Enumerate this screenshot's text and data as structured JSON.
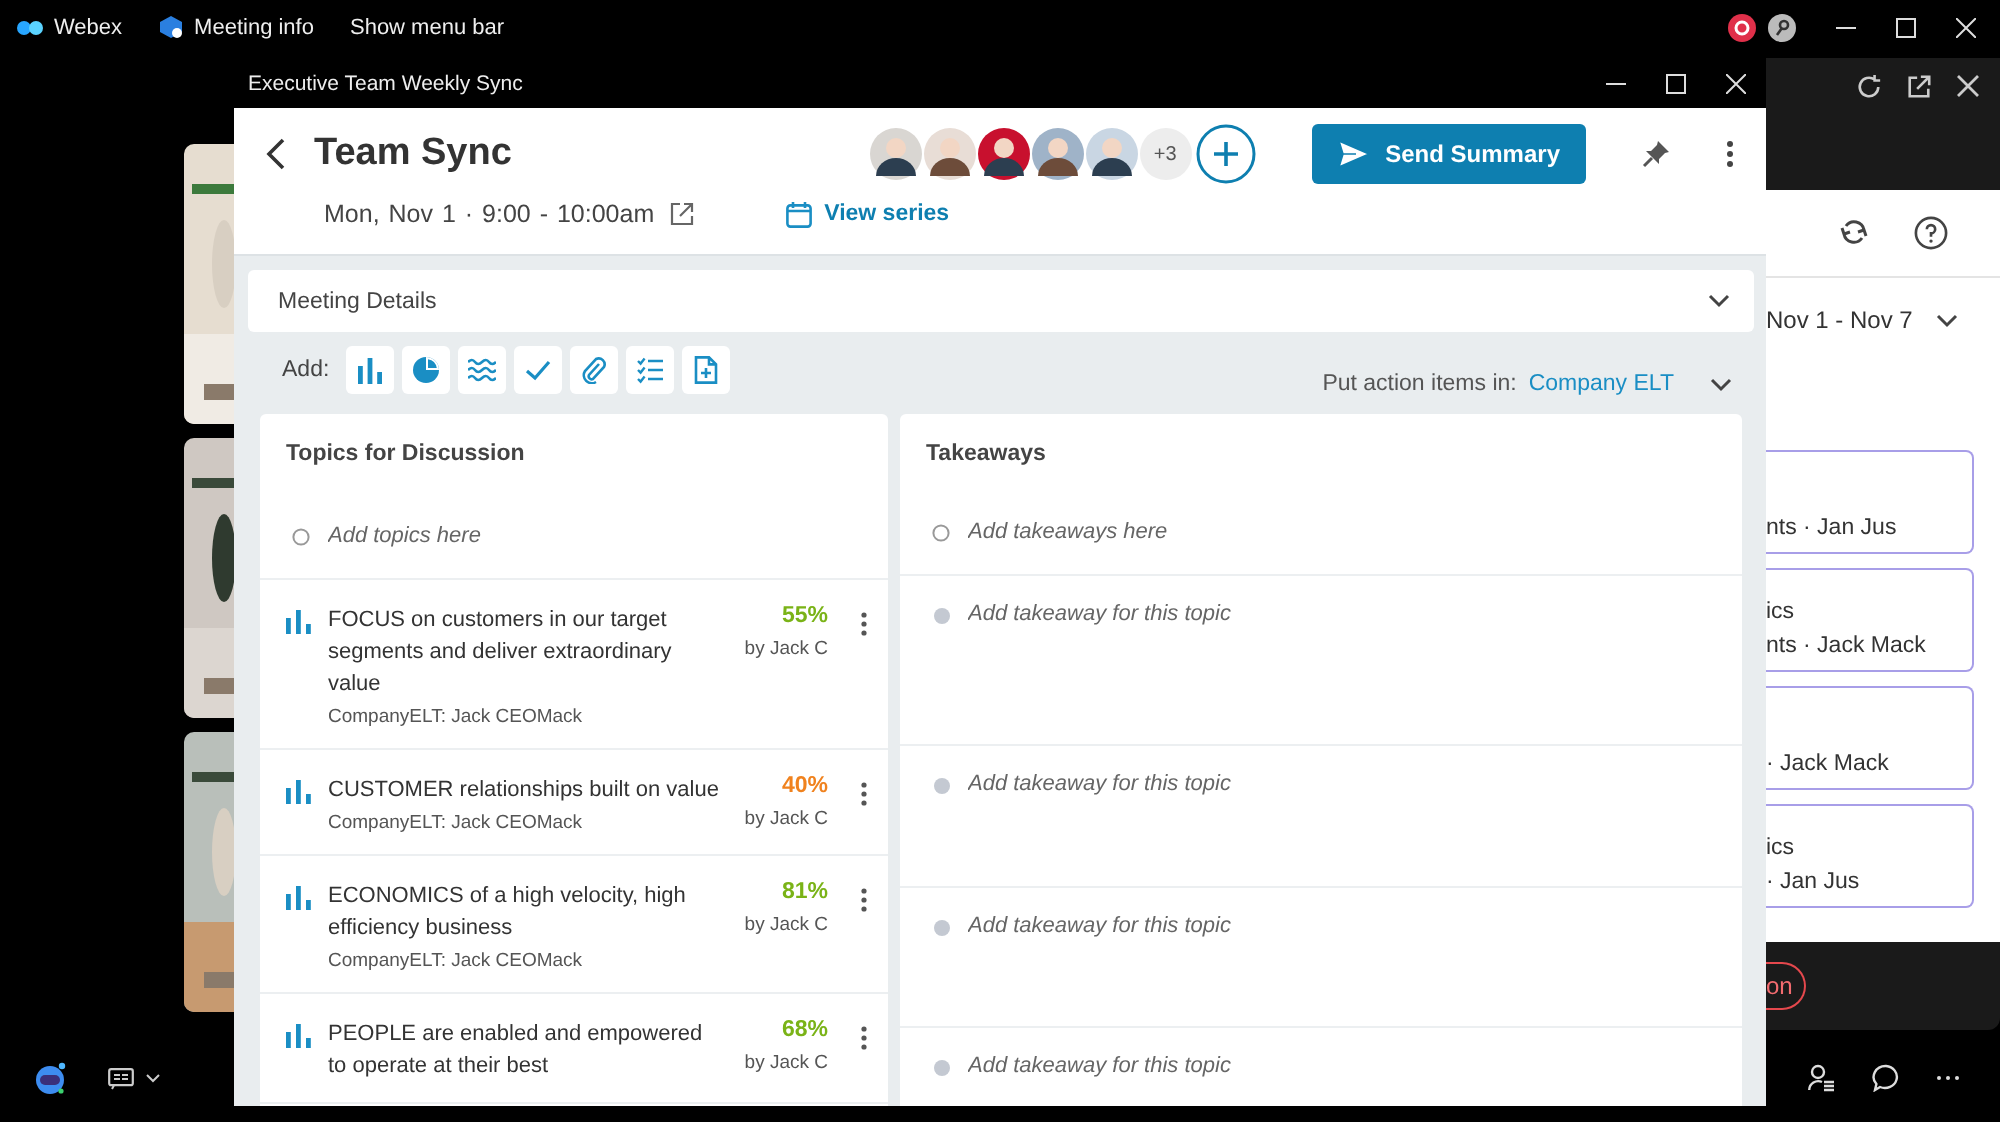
{
  "topbar": {
    "app": "Webex",
    "meeting_info": "Meeting info",
    "menu": "Show menu bar"
  },
  "dialog": {
    "title": "Executive Team Weekly Sync",
    "meeting_title": "Team Sync",
    "when": "Mon, Nov 1 · 9:00 - 10:00am",
    "view_series": "View series",
    "extra_attendees": "+3",
    "send_button": "Send Summary"
  },
  "details": {
    "label": "Meeting Details"
  },
  "add": {
    "label": "Add:",
    "tools": [
      {
        "kind": "bars"
      },
      {
        "kind": "pie"
      },
      {
        "kind": "waves"
      },
      {
        "kind": "check"
      },
      {
        "kind": "clip"
      },
      {
        "kind": "checklist"
      },
      {
        "kind": "file"
      }
    ]
  },
  "action_items": {
    "label": "Put action items in:",
    "value": "Company ELT"
  },
  "topics": {
    "heading": "Topics for Discussion",
    "placeholder": "Add topics here",
    "items": [
      {
        "title": "FOCUS on customers in our target segments and deliver extraordinary value",
        "meta": "CompanyELT: Jack CEOMack",
        "percent": "55%",
        "color": "#7ab317",
        "author": "by Jack C"
      },
      {
        "title": "CUSTOMER relationships built on value",
        "meta": "CompanyELT: Jack CEOMack",
        "percent": "40%",
        "color": "#f0821e",
        "author": "by Jack C"
      },
      {
        "title": "ECONOMICS of a high velocity, high efficiency business",
        "meta": "CompanyELT: Jack CEOMack",
        "percent": "81%",
        "color": "#7ab317",
        "author": "by Jack C"
      },
      {
        "title": "PEOPLE are enabled and empowered to operate at their best",
        "percent": "68%",
        "color": "#7ab317",
        "author": "by Jack C"
      }
    ]
  },
  "takeaways": {
    "heading": "Takeaways",
    "placeholder": "Add takeaways here",
    "items": [
      {
        "placeholder": "Add takeaway for this topic"
      },
      {
        "placeholder": "Add takeaway for this topic"
      },
      {
        "placeholder": "Add takeaway for this topic"
      },
      {
        "placeholder": "Add takeaway for this topic"
      }
    ]
  },
  "side_panel": {
    "date_range": "Nov 1 - Nov 7",
    "cards": [
      {
        "meta": "nts · Jan Jus"
      },
      {
        "title": "ics",
        "meta": "nts · Jack Mack"
      },
      {
        "meta": "· Jack Mack"
      },
      {
        "title": "ics",
        "meta": "· Jan Jus"
      }
    ],
    "button": "on"
  }
}
